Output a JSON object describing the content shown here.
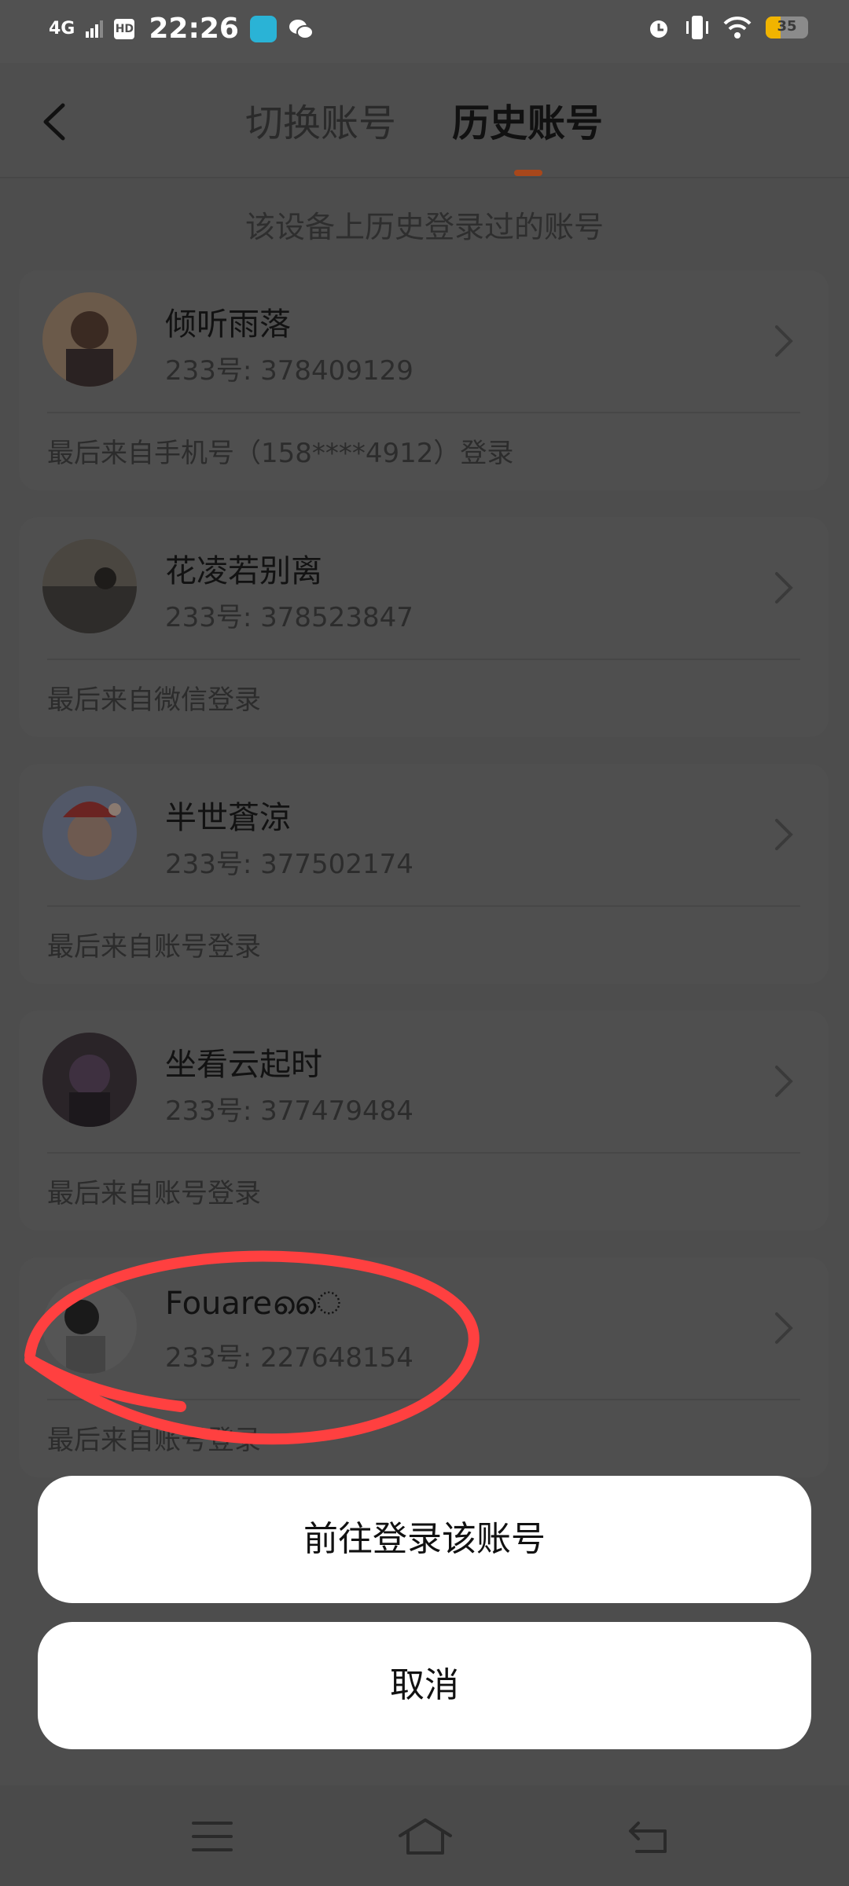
{
  "status_bar": {
    "network": "4G",
    "hd": "HD",
    "time": "22:26",
    "battery": "35",
    "battery_level": 0.35,
    "battery_color": "#f1b400"
  },
  "header": {
    "back_icon": "chevron-left-icon",
    "tabs": [
      {
        "label": "切换账号",
        "active": false
      },
      {
        "label": "历史账号",
        "active": true
      }
    ],
    "accent_color": "#a8471b"
  },
  "subtitle": "该设备上历史登录过的账号",
  "accounts": [
    {
      "name": "倾听雨落",
      "id": "233号: 378409129",
      "source": "最后来自手机号（158****4912）登录"
    },
    {
      "name": "花凌若别离",
      "id": "233号: 378523847",
      "source": "最后来自微信登录"
    },
    {
      "name": "半世蒼涼",
      "id": "233号: 377502174",
      "source": "最后来自账号登录"
    },
    {
      "name": "坐看云起时",
      "id": "233号: 377479484",
      "source": "最后来自账号登录"
    },
    {
      "name": "Fouareൈ",
      "id": "233号: 227648154",
      "source": "最后来自账号登录"
    }
  ],
  "actions": {
    "login_label": "前往登录该账号",
    "cancel_label": "取消"
  },
  "nav": {
    "menu_icon": "menu-icon",
    "home_icon": "home-icon",
    "back_icon": "back-icon"
  }
}
